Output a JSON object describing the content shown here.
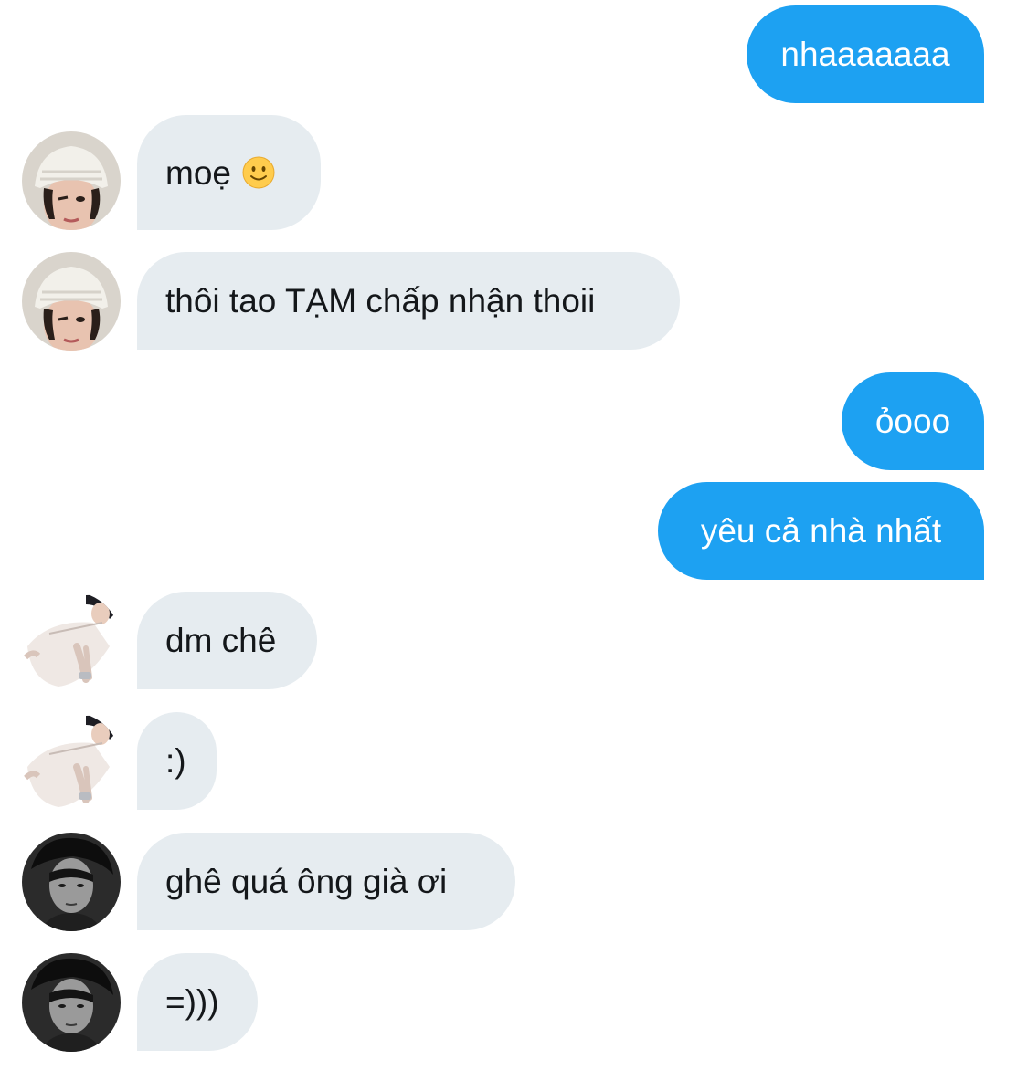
{
  "colors": {
    "sent_bubble": "#1da1f2",
    "received_bubble": "#e6ecf0",
    "sent_text": "#ffffff",
    "received_text": "#14171a"
  },
  "messages": [
    {
      "direction": "sent",
      "text": "nhaaaaaaa"
    },
    {
      "direction": "received",
      "sender": "beanie-user",
      "text": "moẹ",
      "emoji": "slightly-smiling-face-icon"
    },
    {
      "direction": "received",
      "sender": "beanie-user",
      "text": "thôi tao TẠM chấp nhận thoii"
    },
    {
      "direction": "sent",
      "text": "ỏooo"
    },
    {
      "direction": "sent",
      "text": "yêu cả nhà nhất"
    },
    {
      "direction": "received",
      "sender": "white-shirt-user",
      "text": "dm chê"
    },
    {
      "direction": "received",
      "sender": "white-shirt-user",
      "text": ":)"
    },
    {
      "direction": "received",
      "sender": "monochrome-user",
      "text": "ghê quá ông già ơi"
    },
    {
      "direction": "received",
      "sender": "monochrome-user",
      "text": "=)))"
    }
  ]
}
